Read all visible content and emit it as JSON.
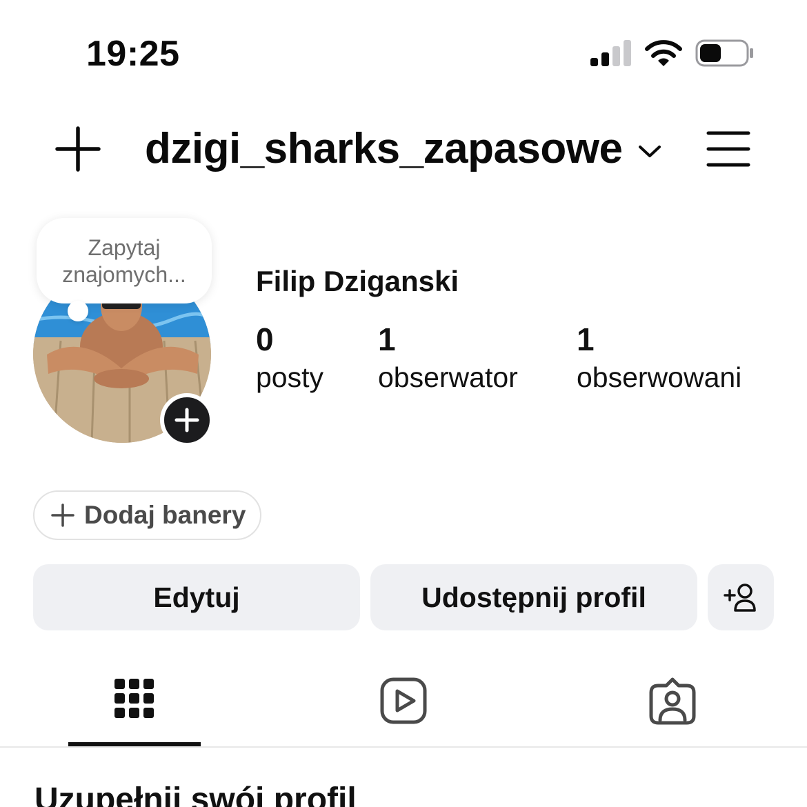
{
  "status_bar": {
    "time": "19:25",
    "icons": [
      "cellular-signal-icon",
      "wifi-icon",
      "battery-icon"
    ]
  },
  "header": {
    "username": "dzigi_sharks_zapasowe",
    "icons": [
      "plus-icon",
      "chevron-down-icon",
      "hamburger-menu-icon"
    ]
  },
  "note": {
    "line1": "Zapytaj",
    "line2": "znajomych..."
  },
  "profile": {
    "full_name": "Filip Dziganski",
    "stats": [
      {
        "value": "0",
        "label": "posty"
      },
      {
        "value": "1",
        "label": "obserwator"
      },
      {
        "value": "1",
        "label": "obserwowani"
      }
    ]
  },
  "banner_button": {
    "label": "Dodaj banery",
    "icon": "plus-icon"
  },
  "actions": {
    "edit_label": "Edytuj",
    "share_label": "Udostępnij profil",
    "discover_icon": "add-person-icon"
  },
  "tabs": [
    {
      "icon": "grid-icon",
      "active": true
    },
    {
      "icon": "reels-play-icon",
      "active": false
    },
    {
      "icon": "tagged-person-icon",
      "active": false
    }
  ],
  "section": {
    "title": "Uzupełnij swój profil"
  },
  "colors": {
    "background": "#ffffff",
    "button_bg": "#eff0f3",
    "text": "#111111",
    "secondary_text": "#6f6f6f",
    "pool_blue": "#2f8fd6"
  }
}
